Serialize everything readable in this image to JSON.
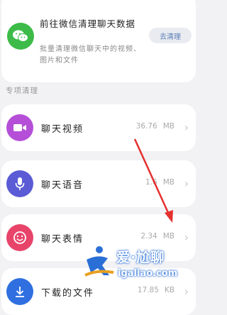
{
  "wechat_card": {
    "title": "前往微信清理聊天数据",
    "description": "批量清理微信聊天中的视频、图片和文件",
    "button": "去清理"
  },
  "section_label": "专项清理",
  "rows": [
    {
      "label": "聊天视频",
      "size": "36.76",
      "unit": "MB",
      "icon": "video-icon",
      "color": "#b54fd8"
    },
    {
      "label": "聊天语音",
      "size": "1.6",
      "unit": "MB",
      "icon": "microphone-icon",
      "color": "#5b5bd6"
    },
    {
      "label": "聊天表情",
      "size": "2.34",
      "unit": "MB",
      "icon": "smiley-icon",
      "color": "#e8446a"
    },
    {
      "label": "下载的文件",
      "size": "17.85",
      "unit": "KB",
      "icon": "download-icon",
      "color": "#2f6fe0"
    }
  ],
  "watermark": {
    "text": "爱·尬聊",
    "url": "igaliao.com"
  }
}
